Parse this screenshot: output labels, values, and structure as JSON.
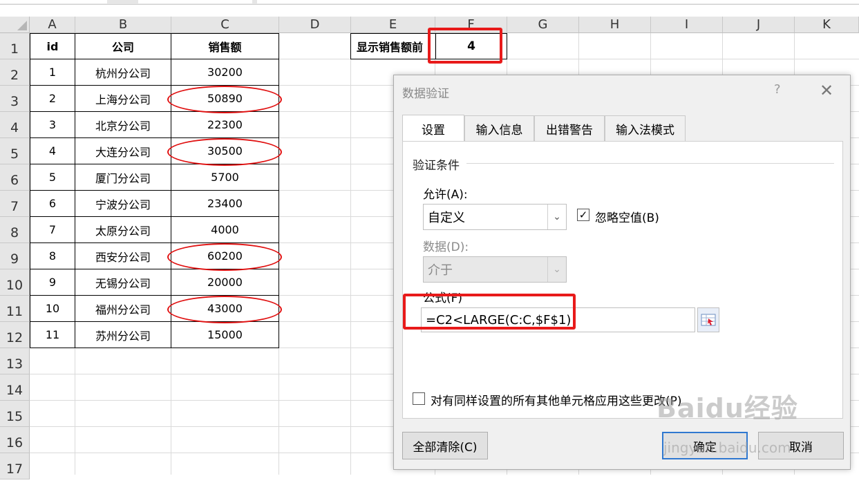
{
  "spreadsheet": {
    "columns": [
      "A",
      "B",
      "C",
      "D",
      "E",
      "F",
      "G",
      "H",
      "I",
      "J",
      "K"
    ],
    "rows": [
      "1",
      "2",
      "3",
      "4",
      "5",
      "6",
      "7",
      "8",
      "9",
      "10",
      "11",
      "12",
      "13",
      "14",
      "15",
      "16",
      "17"
    ],
    "table_headers": [
      "id",
      "公司",
      "销售额"
    ],
    "table_rows": [
      [
        "1",
        "杭州分公司",
        "30200"
      ],
      [
        "2",
        "上海分公司",
        "50890"
      ],
      [
        "3",
        "北京分公司",
        "22300"
      ],
      [
        "4",
        "大连分公司",
        "30500"
      ],
      [
        "5",
        "厦门分公司",
        "5700"
      ],
      [
        "6",
        "宁波分公司",
        "23400"
      ],
      [
        "7",
        "太原分公司",
        "4000"
      ],
      [
        "8",
        "西安分公司",
        "60200"
      ],
      [
        "9",
        "无锡分公司",
        "20000"
      ],
      [
        "10",
        "福州分公司",
        "43000"
      ],
      [
        "11",
        "苏州分公司",
        "15000"
      ]
    ],
    "label_cell": "显示销售额前",
    "value_cell": "4",
    "highlight_color": "#e01010"
  },
  "dialog": {
    "title": "数据验证",
    "help": "?",
    "close": "✕",
    "tabs": [
      "设置",
      "输入信息",
      "出错警告",
      "输入法模式"
    ],
    "active_tab": "设置",
    "group_label": "验证条件",
    "allow_label": "允许(A):",
    "allow_value": "自定义",
    "ignore_blank_label": "忽略空值(B)",
    "ignore_blank_checked": true,
    "data_label": "数据(D):",
    "data_value": "介于",
    "formula_label": "公式(F)",
    "formula_value": "=C2<LARGE(C:C,$F$1)",
    "apply_all_label": "对有同样设置的所有其他单元格应用这些更改(P)",
    "apply_all_checked": false,
    "clear_all": "全部清除(C)",
    "ok": "确定",
    "cancel": "取消"
  },
  "watermark": {
    "text": "Baidu经验",
    "url": "jingyan.baidu.com"
  }
}
